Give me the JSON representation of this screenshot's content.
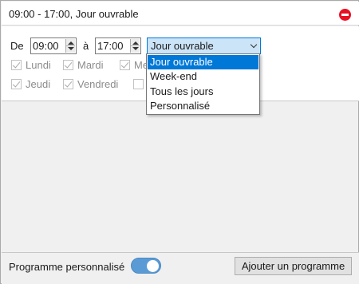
{
  "header": {
    "title": "09:00 - 17:00, Jour ouvrable",
    "remove_icon": "remove-circle-icon",
    "remove_icon_color": "#e81123"
  },
  "schedule": {
    "from_label": "De",
    "from_time": "09:00",
    "to_label": "à",
    "to_time": "17:00",
    "preset_selected": "Jour ouvrable",
    "preset_options": [
      "Jour ouvrable",
      "Week-end",
      "Tous les jours",
      "Personnalisé"
    ],
    "days": [
      {
        "label": "Lundi",
        "checked": true
      },
      {
        "label": "Mardi",
        "checked": true
      },
      {
        "label": "Me",
        "checked": true
      },
      {
        "label": "Jeudi",
        "checked": true
      },
      {
        "label": "Vendredi",
        "checked": true
      },
      {
        "label": "",
        "checked": false
      }
    ]
  },
  "footer": {
    "custom_program_label": "Programme personnalisé",
    "custom_program_enabled": true,
    "add_program_button": "Ajouter un programme"
  },
  "colors": {
    "accent": "#0078d7",
    "toggle_on": "#5b9bd5"
  }
}
